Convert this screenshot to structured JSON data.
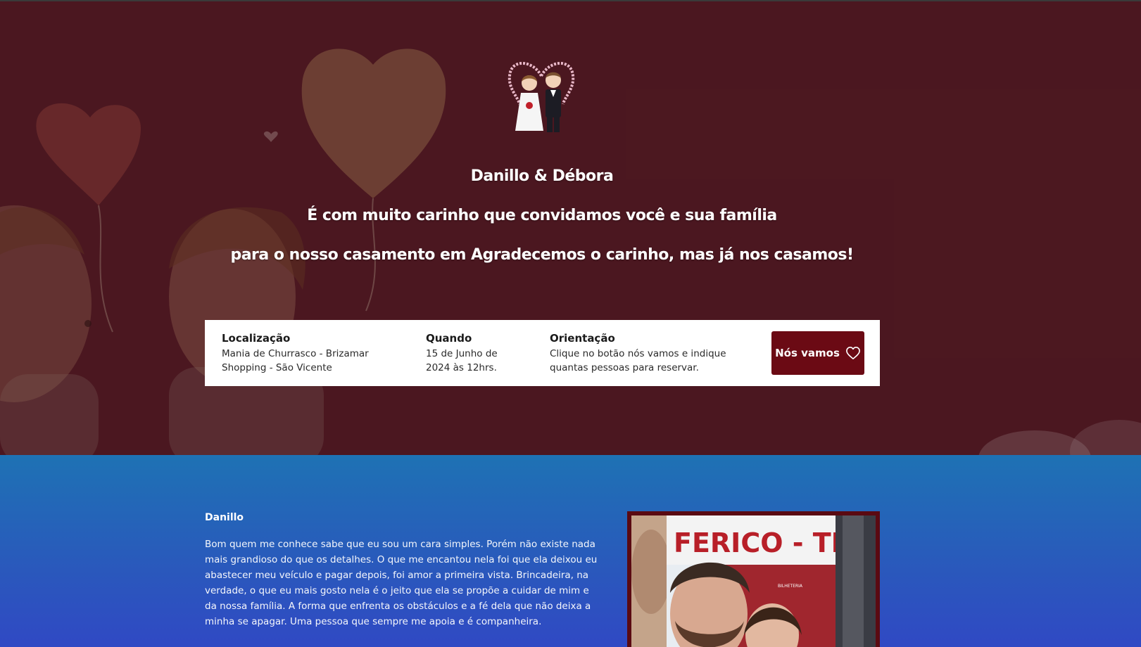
{
  "hero": {
    "names": "Danillo & Débora",
    "line1": "É com muito carinho que convidamos você e sua família",
    "line2": "para o nosso casamento em Agradecemos o carinho, mas já nos casamos!"
  },
  "info": {
    "location_label": "Localização",
    "location_value": "Mania de Churrasco - Brizamar Shopping - São Vicente",
    "when_label": "Quando",
    "when_value": "15 de Junho de 2024 às 12hrs.",
    "guide_label": "Orientação",
    "guide_value": "Clique no botão nós vamos e indique quantas pessoas para reservar.",
    "button_label": "Nós vamos",
    "button_icon": "heart-icon"
  },
  "bio": {
    "name": "Danillo",
    "text": "Bom quem me conhece sabe que eu sou um cara simples. Porém não existe nada mais grandioso do que os detalhes. O que me encantou nela foi que ela deixou eu abastecer meu veículo e pagar depois, foi amor a primeira vista. Brincadeira, na verdade, o que eu mais gosto nela é o jeito que ela se propõe a cuidar de mim e da nossa família. A forma que enfrenta os obstáculos e a fé dela que não deixa a minha se apagar. Uma pessoa que sempre me apoia e é companheira.",
    "photo_sign": "FERICO - TRE",
    "photo_small_sign": "BILHETERIA"
  },
  "colors": {
    "hero_bg": "#4a1c25",
    "button_bg": "#6b0a14",
    "section_top": "#1e72b4",
    "section_bottom": "#3049c4"
  }
}
